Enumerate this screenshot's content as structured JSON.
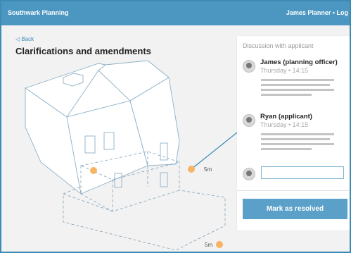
{
  "header": {
    "brand": "Southwark Planning",
    "user": "James Planner • Log o"
  },
  "back_label": "Back",
  "page_title": "Clarifications and amendments",
  "drawing": {
    "dimension_labels": [
      "5m",
      "5m"
    ]
  },
  "discussion": {
    "title": "Discussion with applicant",
    "messages": [
      {
        "author": "James (planning officer)",
        "time": "Thursday • 14:15"
      },
      {
        "author": "Ryan (applicant)",
        "time": "Thursday • 14:15"
      }
    ],
    "reply_value": "",
    "resolve_label": "Mark as resolved"
  },
  "colors": {
    "header": "#4b97c2",
    "button": "#5ba0c8",
    "marker": "#f7b464"
  }
}
